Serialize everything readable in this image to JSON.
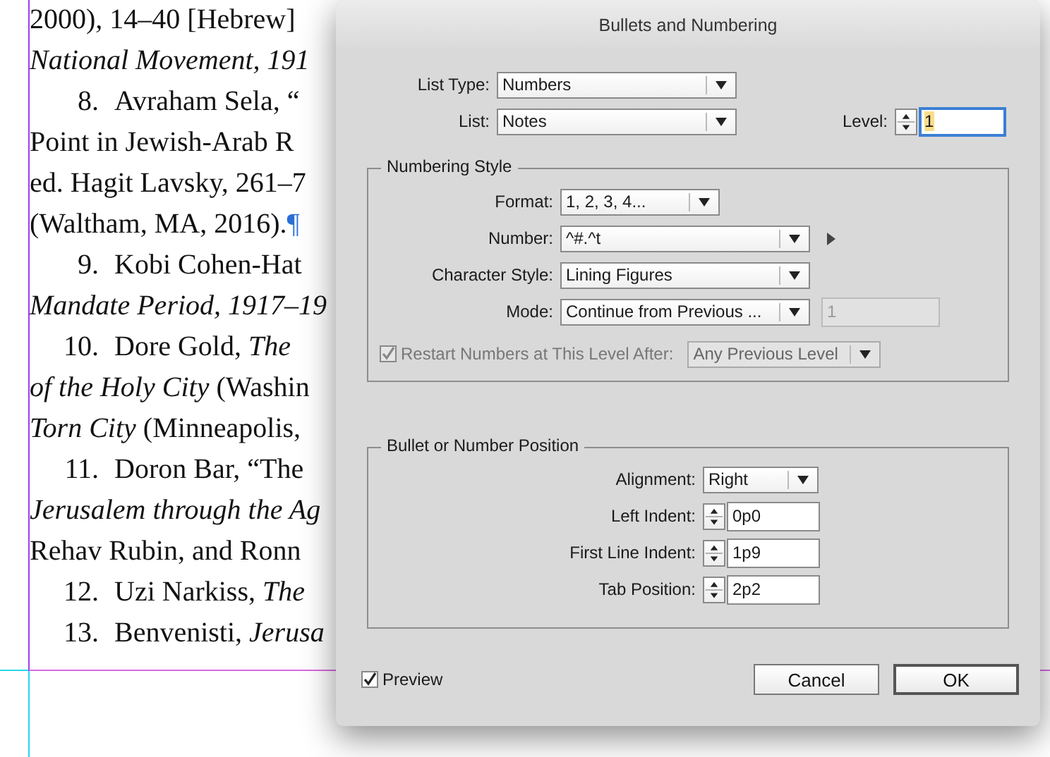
{
  "document": {
    "lines": [
      {
        "text": "2000), 14–40 [Hebrew]"
      },
      {
        "text": "National Movement, 191",
        "italic": true
      },
      {
        "num": "8.",
        "text": "Avraham Sela, “"
      },
      {
        "text": "Point in Jewish-Arab R"
      },
      {
        "text": "ed. Hagit Lavsky, 261–7"
      },
      {
        "text": "(Waltham, MA, 2016).",
        "mark": "¶"
      },
      {
        "num": "9.",
        "text": "Kobi Cohen-Hat"
      },
      {
        "text": "Mandate Period, 1917–19",
        "italic": true
      },
      {
        "num": "10.",
        "text": "Dore Gold, *The*"
      },
      {
        "text": "*of the Holy City* (Washin"
      },
      {
        "text": "*Torn City* (Minneapolis,"
      },
      {
        "num": "11.",
        "text": "Doron Bar, “The"
      },
      {
        "text": "Jerusalem through the Ag",
        "italic": true
      },
      {
        "text": "Rehav Rubin, and Ronn"
      },
      {
        "num": "12.",
        "text": "Uzi Narkiss, *The*"
      },
      {
        "num": "13.",
        "text": "Benvenisti, *Jerusa*"
      }
    ]
  },
  "dialog": {
    "title": "Bullets and Numbering",
    "list_type": {
      "label": "List Type:",
      "value": "Numbers"
    },
    "list": {
      "label": "List:",
      "value": "Notes"
    },
    "level": {
      "label": "Level:",
      "value": "1"
    },
    "numbering_style": {
      "title": "Numbering Style",
      "format": {
        "label": "Format:",
        "value": "1, 2, 3, 4..."
      },
      "number": {
        "label": "Number:",
        "value": "^#.^t"
      },
      "character_style": {
        "label": "Character Style:",
        "value": "Lining Figures"
      },
      "mode": {
        "label": "Mode:",
        "value": "Continue from Previous ...",
        "start_value": "1",
        "start_disabled": true
      },
      "restart": {
        "label": "Restart Numbers at This Level After:",
        "checked": true,
        "disabled": true,
        "after": "Any Previous Level"
      }
    },
    "position": {
      "title": "Bullet or Number Position",
      "alignment": {
        "label": "Alignment:",
        "value": "Right"
      },
      "indents": [
        {
          "label": "Left Indent:",
          "value": "0p0"
        },
        {
          "label": "First Line Indent:",
          "value": "1p9"
        },
        {
          "label": "Tab Position:",
          "value": "2p2"
        }
      ]
    },
    "preview": {
      "label": "Preview",
      "checked": true
    },
    "buttons": [
      {
        "label": "Cancel",
        "default": false
      },
      {
        "label": "OK",
        "default": true
      }
    ]
  }
}
